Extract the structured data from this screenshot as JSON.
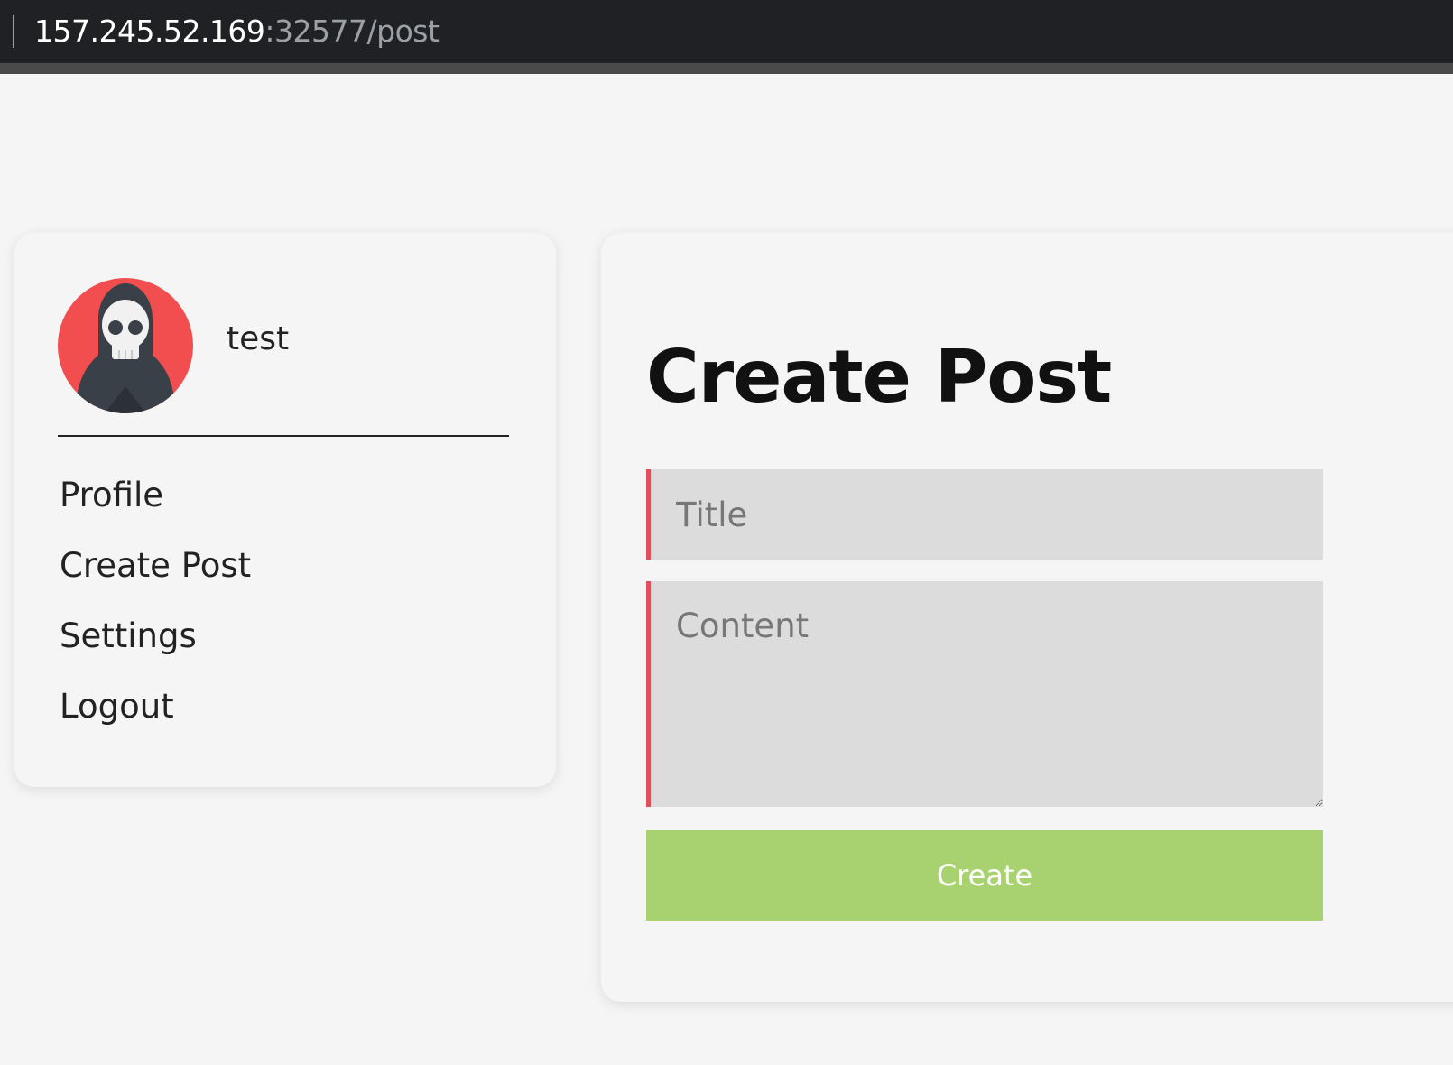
{
  "browser": {
    "url_host": "157.245.52.169",
    "url_rest": ":32577/post"
  },
  "sidebar": {
    "username": "test",
    "avatar_icon": "skull-hood-icon",
    "items": [
      {
        "label": "Profile"
      },
      {
        "label": "Create Post"
      },
      {
        "label": "Settings"
      },
      {
        "label": "Logout"
      }
    ]
  },
  "main": {
    "title": "Create Post",
    "title_placeholder": "Title",
    "content_placeholder": "Content",
    "submit_label": "Create"
  },
  "colors": {
    "accent_border": "#e0505a",
    "button": "#a8d26f",
    "avatar_bg": "#f24e4f"
  }
}
